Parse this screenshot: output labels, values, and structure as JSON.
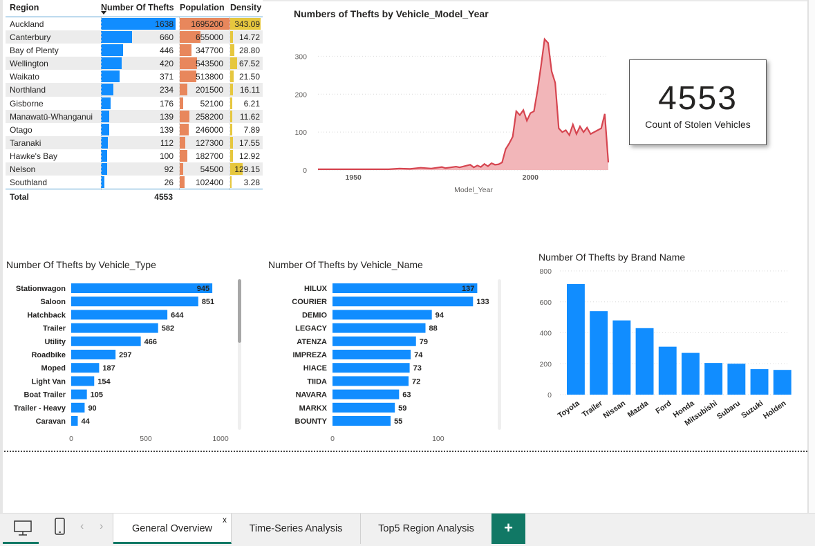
{
  "table": {
    "headers": {
      "region": "Region",
      "thefts": "Number Of Thefts",
      "population": "Population",
      "density": "Density"
    },
    "rows": [
      {
        "region": "Auckland",
        "thefts": "1638",
        "population": "1695200",
        "density": "343.09"
      },
      {
        "region": "Canterbury",
        "thefts": "660",
        "population": "655000",
        "density": "14.72"
      },
      {
        "region": "Bay of Plenty",
        "thefts": "446",
        "population": "347700",
        "density": "28.80"
      },
      {
        "region": "Wellington",
        "thefts": "420",
        "population": "543500",
        "density": "67.52"
      },
      {
        "region": "Waikato",
        "thefts": "371",
        "population": "513800",
        "density": "21.50"
      },
      {
        "region": "Northland",
        "thefts": "234",
        "population": "201500",
        "density": "16.11"
      },
      {
        "region": "Gisborne",
        "thefts": "176",
        "population": "52100",
        "density": "6.21"
      },
      {
        "region": "Manawatū-Whanganui",
        "thefts": "139",
        "population": "258200",
        "density": "11.62"
      },
      {
        "region": "Otago",
        "thefts": "139",
        "population": "246000",
        "density": "7.89"
      },
      {
        "region": "Taranaki",
        "thefts": "112",
        "population": "127300",
        "density": "17.55"
      },
      {
        "region": "Hawke's Bay",
        "thefts": "100",
        "population": "182700",
        "density": "12.92"
      },
      {
        "region": "Nelson",
        "thefts": "92",
        "population": "54500",
        "density": "129.15"
      },
      {
        "region": "Southland",
        "thefts": "26",
        "population": "102400",
        "density": "3.28"
      }
    ],
    "total_label": "Total",
    "total_thefts": "4553",
    "colors": {
      "thefts": "#118dff",
      "population": "#e8875c",
      "density": "#e6c73e"
    }
  },
  "card": {
    "value": "4553",
    "label": "Count of Stolen Vehicles"
  },
  "model_year_chart": {
    "title": "Numbers of Thefts by Vehicle_Model_Year",
    "chart_data": {
      "type": "area",
      "xlabel": "Model_Year",
      "ylabel": "",
      "xlim": [
        1940,
        2022
      ],
      "ylim": [
        0,
        350
      ],
      "x_ticks": [
        1950,
        2000
      ],
      "y_ticks": [
        0,
        100,
        200,
        300
      ],
      "x": [
        1940,
        1960,
        1963,
        1966,
        1969,
        1972,
        1975,
        1976,
        1979,
        1980,
        1983,
        1984,
        1985,
        1986,
        1987,
        1988,
        1989,
        1990,
        1991,
        1992,
        1993,
        1994,
        1995,
        1996,
        1997,
        1998,
        1999,
        2000,
        2001,
        2002,
        2003,
        2004,
        2005,
        2006,
        2007,
        2008,
        2009,
        2010,
        2011,
        2012,
        2013,
        2014,
        2015,
        2016,
        2017,
        2018,
        2019,
        2020,
        2021,
        2022
      ],
      "y": [
        2,
        2,
        4,
        3,
        6,
        4,
        8,
        5,
        9,
        7,
        14,
        7,
        12,
        8,
        16,
        10,
        18,
        14,
        15,
        20,
        55,
        70,
        88,
        155,
        145,
        158,
        130,
        150,
        155,
        210,
        275,
        345,
        335,
        260,
        230,
        110,
        100,
        105,
        92,
        120,
        95,
        115,
        100,
        112,
        95,
        100,
        105,
        110,
        148,
        20
      ],
      "colors": {
        "line": "#d64550",
        "fill": "#f2b6b9"
      }
    }
  },
  "vehicle_type_chart": {
    "title": "Number Of Thefts by Vehicle_Type",
    "chart_data": {
      "type": "bar",
      "orientation": "horizontal",
      "categories": [
        "Stationwagon",
        "Saloon",
        "Hatchback",
        "Trailer",
        "Utility",
        "Roadbike",
        "Moped",
        "Light Van",
        "Boat Trailer",
        "Trailer - Heavy",
        "Caravan"
      ],
      "values": [
        945,
        851,
        644,
        582,
        466,
        297,
        187,
        154,
        105,
        90,
        44
      ],
      "xlim": [
        0,
        1000
      ],
      "x_ticks": [
        0,
        500,
        1000
      ],
      "color": "#118dff"
    }
  },
  "vehicle_name_chart": {
    "title": "Number Of Thefts by Vehicle_Name",
    "chart_data": {
      "type": "bar",
      "orientation": "horizontal",
      "categories": [
        "HILUX",
        "COURIER",
        "DEMIO",
        "LEGACY",
        "ATENZA",
        "IMPREZA",
        "HIACE",
        "TIIDA",
        "NAVARA",
        "MARKX",
        "BOUNTY"
      ],
      "values": [
        137,
        133,
        94,
        88,
        79,
        74,
        73,
        72,
        63,
        59,
        55
      ],
      "xlim": [
        0,
        140
      ],
      "x_ticks": [
        0,
        100
      ],
      "color": "#118dff"
    }
  },
  "brand_chart": {
    "title": "Number Of Thefts by Brand Name",
    "chart_data": {
      "type": "bar",
      "orientation": "vertical",
      "categories": [
        "Toyota",
        "Trailer",
        "Nissan",
        "Mazda",
        "Ford",
        "Honda",
        "Mitsubishi",
        "Subaru",
        "Suzuki",
        "Holden"
      ],
      "values": [
        715,
        540,
        480,
        430,
        310,
        270,
        205,
        200,
        165,
        160
      ],
      "ylim": [
        0,
        800
      ],
      "y_ticks": [
        0,
        200,
        400,
        600,
        800
      ],
      "color": "#118dff"
    }
  },
  "footer": {
    "desktop_icon": "desktop-icon",
    "mobile_icon": "mobile-icon",
    "prev_icon": "‹",
    "next_icon": "›",
    "tabs": [
      "General Overview",
      "Time-Series Analysis",
      "Top5 Region Analysis"
    ],
    "close_label": "x",
    "add_label": "+",
    "accent": "#117865"
  }
}
